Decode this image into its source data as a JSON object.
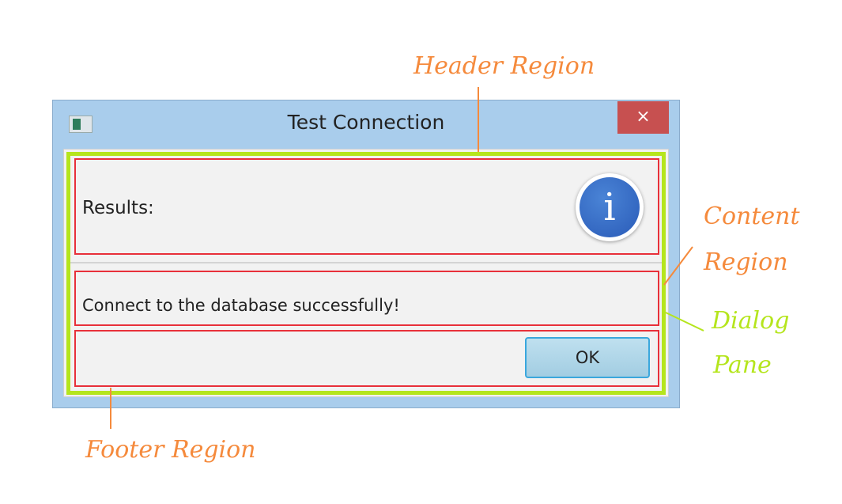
{
  "dialog": {
    "title": "Test Connection",
    "close_icon": "×",
    "header_text": "Results:",
    "info_icon": "i",
    "content_text": "Connect to the database successfully!",
    "ok_label": "OK"
  },
  "annotations": {
    "header": "Header Region",
    "content_1": "Content",
    "content_2": "Region",
    "pane_1": "Dialog",
    "pane_2": "Pane",
    "footer": "Footer Region"
  },
  "colors": {
    "annotation": "#f58a3c",
    "pane_outline": "#b5e51d",
    "region_outline": "#e8303a"
  }
}
